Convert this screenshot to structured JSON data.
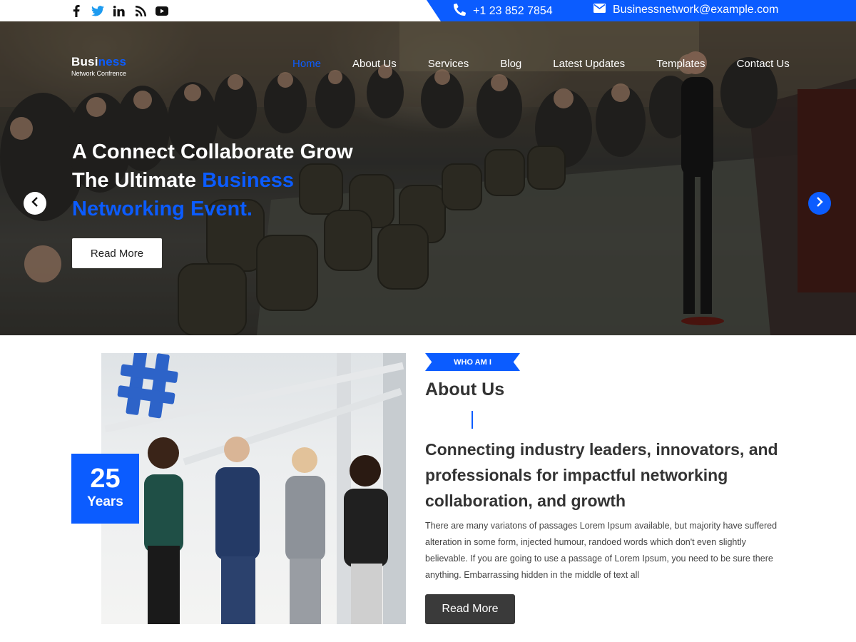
{
  "topbar": {
    "social": [
      {
        "icon": "facebook-icon",
        "glyph": "f"
      },
      {
        "icon": "twitter-icon",
        "glyph": "t"
      },
      {
        "icon": "linkedin-icon",
        "glyph": "in"
      },
      {
        "icon": "rss-icon",
        "glyph": "rss"
      },
      {
        "icon": "youtube-icon",
        "glyph": "yt"
      }
    ],
    "phone": "+1 23 852 7854",
    "email": "Businessnetwork@example.com",
    "accent": "#0b5cff"
  },
  "logo": {
    "part1": "Busi",
    "part2": "ness",
    "sub": "Network Confrence"
  },
  "nav": {
    "items": [
      "Home",
      "About Us",
      "Services",
      "Blog",
      "Latest Updates",
      "Templates",
      "Contact Us"
    ],
    "active": "Home"
  },
  "hero": {
    "line1": "A Connect Collaborate Grow",
    "line2_white": "The Ultimate ",
    "line2_blue": "Business",
    "line3_blue": "Networking Event.",
    "button": "Read More",
    "prev_icon": "chevron-left-icon",
    "next_icon": "chevron-right-icon"
  },
  "about": {
    "years_number": "25",
    "years_label": "Years",
    "tag": "WHO AM I",
    "title": "About Us",
    "heading": "Connecting industry leaders, innovators, and professionals for impactful networking collaboration, and growth",
    "body": "There are many variatons of passages Lorem Ipsum available, but majority have suffered alteration in some form, injected humour, randoed words which don't even slightly believable. If you are going to use a passage of Lorem Ipsum, you need to be sure there anything. Embarrassing hidden in the middle of text all",
    "button": "Read More"
  }
}
